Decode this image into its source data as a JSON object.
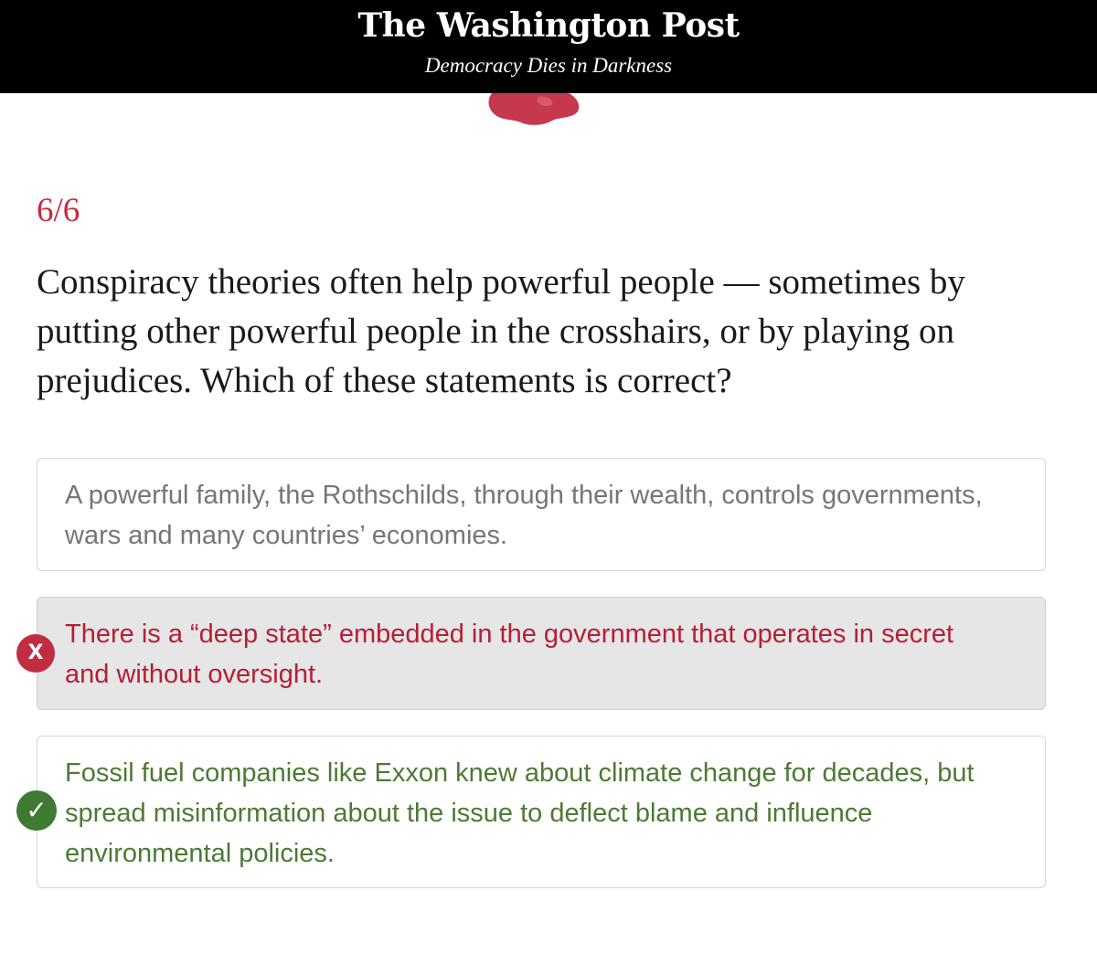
{
  "masthead": {
    "logo": "The Washington Post",
    "tagline": "Democracy Dies in Darkness"
  },
  "quiz": {
    "counter": "6/6",
    "question": "Conspiracy theories often help powerful people — sometimes by putting other powerful people in the crosshairs, or by playing on prejudices. Which of these statements is correct?",
    "options": [
      {
        "text": "A powerful family, the Rothschilds, through their wealth, controls governments, wars and many countries’ economies.",
        "state": "neutral"
      },
      {
        "text": "There is a “deep state” embedded in the government that operates in secret and without oversight.",
        "state": "incorrect",
        "badge": "X"
      },
      {
        "text": "Fossil fuel companies like Exxon knew about climate change for decades, but spread misinformation about the issue to deflect blame and influence environmental policies.",
        "state": "correct",
        "badge": "✓"
      }
    ]
  },
  "colors": {
    "masthead_bg": "#000000",
    "accent_red": "#c8283f",
    "incorrect_bg": "#e6e6e6",
    "correct_green": "#4c7a34"
  },
  "icons": [
    "x-icon",
    "check-icon",
    "illustration-blob"
  ]
}
